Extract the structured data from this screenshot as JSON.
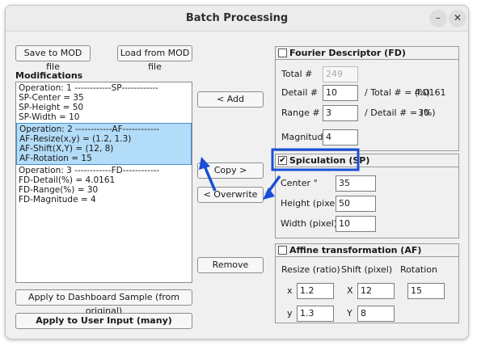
{
  "window": {
    "title": "Batch Processing",
    "minimize_icon": "–",
    "close_icon": "✕"
  },
  "toolbar": {
    "save_mod": "Save to MOD file",
    "load_mod": "Load from MOD file"
  },
  "modifications": {
    "heading": "Modifications",
    "ops": [
      {
        "lines": [
          "Operation: 1 ------------SP------------",
          "SP-Center = 35",
          "SP-Height = 50",
          "SP-Width = 10"
        ]
      },
      {
        "lines": [
          "Operation: 2 ------------AF------------",
          "AF-Resize(x,y) = (1.2, 1.3)",
          "AF-Shift(X,Y) = (12, 8)",
          "AF-Rotation = 15"
        ]
      },
      {
        "lines": [
          "Operation: 3 ------------FD------------",
          "FD-Detail(%) = 4.0161",
          "FD-Range(%) = 30",
          "FD-Magnitude = 4"
        ]
      }
    ]
  },
  "middle": {
    "add": "< Add",
    "copy": "Copy >",
    "overwrite": "< Overwrite",
    "remove": "Remove"
  },
  "bottom": {
    "apply_dashboard": "Apply to Dashboard Sample (from original)",
    "apply_user": "Apply to User Input (many)"
  },
  "fd": {
    "title": "Fourier Descriptor (FD)",
    "checked": false,
    "total_label": "Total #",
    "total_value": "249",
    "detail_label": "Detail #",
    "detail_value": "10",
    "detail_ratio_label": "/ Total # = (%)",
    "detail_ratio_value": "4.0161",
    "range_label": "Range #",
    "range_value": "3",
    "range_ratio_label": "/ Detail # = (%)",
    "range_ratio_value": "30",
    "magnitude_label": "Magnitude",
    "magnitude_value": "4"
  },
  "sp": {
    "title": "Spiculation (SP)",
    "checked": true,
    "check_glyph": "✔",
    "center_label": "Center °",
    "center_value": "35",
    "height_label": "Height  (pixel)",
    "height_value": "50",
    "width_label": "Width  (pixel)",
    "width_value": "10"
  },
  "af": {
    "title": "Affine transformation (AF)",
    "checked": false,
    "resize_label": "Resize (ratio)",
    "shift_label": "Shift (pixel)",
    "rotation_label": "Rotation",
    "x_label": "x",
    "y_label": "y",
    "X_label": "X",
    "Y_label": "Y",
    "resize_x": "1.2",
    "resize_y": "1.3",
    "shift_x": "12",
    "shift_y": "8",
    "rotation": "15"
  },
  "annotation": {
    "color": "#1a4fd6"
  }
}
